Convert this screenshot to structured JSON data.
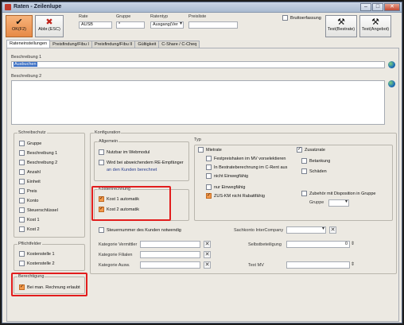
{
  "window": {
    "title": "Raten - Zeilenlupe",
    "minimize": "–",
    "maximize": "□",
    "close": "✕"
  },
  "toolbar": {
    "ok": "OK(F2)",
    "cancel": "Abbr.(ESC)",
    "rate_label": "Rate",
    "rate_value": "AUSB",
    "gruppe_label": "Gruppe",
    "gruppe_value": "*",
    "ratentyp_label": "Ratentyp",
    "ratentyp_value": "Ausgang(Ver",
    "preisliste_label": "Preisliste",
    "preisliste_value": "",
    "brutto_label": "Bruttoerfassung",
    "test_bestrate": "Test(Bestrate)",
    "test_angebot": "Test(Angebot)"
  },
  "tabs": [
    "Rateneinstellungen",
    "Preisfindung/Fibu I",
    "Preisfindung/Fibu II",
    "Gültigkeit",
    "C-Share / C-Cheq"
  ],
  "beschreibung1": {
    "label": "Beschreibung 1",
    "value": "Ausbuchen"
  },
  "beschreibung2": {
    "label": "Beschreibung 2",
    "value": ""
  },
  "schreibschutz": {
    "title": "Schreibschutz",
    "items": [
      "Gruppe",
      "Beschreibung 1",
      "Beschreibung 2",
      "Anzahl",
      "Einheit",
      "Preis",
      "Konto",
      "Steuerschlüssel",
      "Kost 1",
      "Kost 2"
    ]
  },
  "pflichtfelder": {
    "title": "Pflichtfelder",
    "items": [
      "Kostenstelle 1",
      "Kostenstelle 2"
    ]
  },
  "berechtigung": {
    "title": "Berechtigung",
    "item": "Bei man. Rechnung erlaubt"
  },
  "konfiguration": {
    "title": "Konfiguration",
    "allgemein_title": "Allgemein",
    "nutzbar": "Nutzbar im Webmodul",
    "wird_bei": "Wird bei abweichendem RE-Empfänger",
    "an_den": "an den Kunden berechnet",
    "kostenrechnung_title": "Kostenrechnung",
    "kost1": "Kost 1 automatik",
    "kost2": "Kost 2 automatik",
    "typ_title": "Typ",
    "mietrate": "Mietrate",
    "festpreishaken": "Festpreishaken im MV vorselektieren",
    "bestrate": "In Bestrateberechnung im C-Rent aus",
    "nicht_einweg1": "nicht Einwegfähig",
    "nur_einweg": "nur Einwegfähig",
    "zus_km": "ZUS-KM nicht Rabattfähig",
    "zusatzrate": "Zusatzrate",
    "betankung": "Betankung",
    "schaeden": "Schäden",
    "zubehoer": "Zubehör mit Disposition in Gruppe",
    "gruppe": "Gruppe",
    "steuernummer": "Steuernummer des Kunden notwendig",
    "sachkonto": "Sachkonto InterCompany",
    "kat_vermittler": "Kategorie Vermittler",
    "kat_filialen": "Kategorie Filialen",
    "kat_auswert": "Kategorie Ausw.",
    "selbstbeteiligung": "Selbstbeteiligung",
    "selbstbeteiligung_value": "0",
    "text_mv": "Text MV"
  },
  "icons": {
    "ok": "check-icon",
    "cancel": "x-icon",
    "test": "tools-icon",
    "globe": "globe-icon"
  },
  "colors": {
    "accent": "#f39a4c",
    "highlight": "#e21d1d",
    "selection": "#3a6fc4"
  }
}
